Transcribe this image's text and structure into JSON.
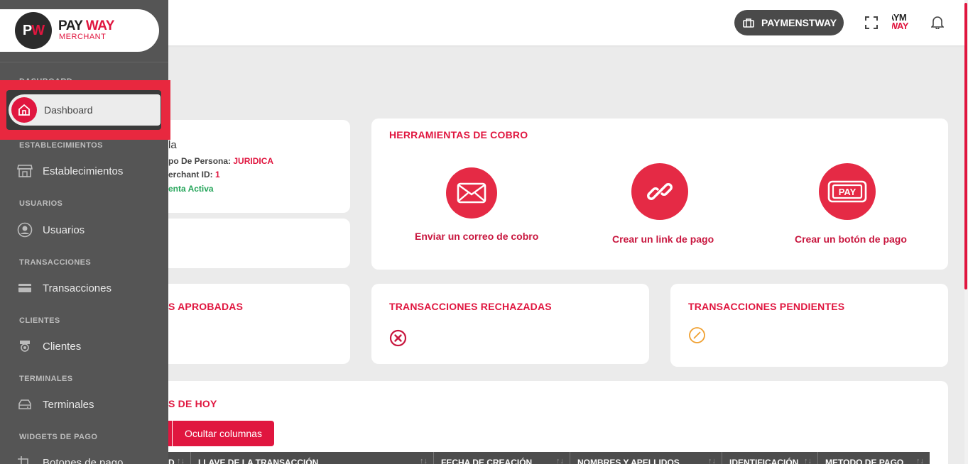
{
  "topbar": {
    "merchant_name": "PAYMENSTWAY",
    "mini_logo_line1": "AYM",
    "mini_logo_line2": "WAY"
  },
  "sidebar": {
    "logo_initials_p": "P",
    "logo_initials_w": "W",
    "logo_pay": "PAY",
    "logo_way": "WAY",
    "logo_sub": "MERCHANT",
    "hidden_section": "DASHBOARD",
    "active_item": "Dashboard",
    "sections": [
      {
        "title": "ESTABLECIMIENTOS",
        "item": "Establecimientos",
        "icon": "store-icon"
      },
      {
        "title": "USUARIOS",
        "item": "Usuarios",
        "icon": "user-icon"
      },
      {
        "title": "TRANSACCIONES",
        "item": "Transacciones",
        "icon": "card-icon"
      },
      {
        "title": "CLIENTES",
        "item": "Clientes",
        "icon": "clients-icon"
      },
      {
        "title": "TERMINALES",
        "item": "Terminales",
        "icon": "terminal-icon"
      },
      {
        "title": "WIDGETS DE PAGO",
        "item": "Botones de pago",
        "icon": "crop-icon"
      }
    ]
  },
  "profile": {
    "name": "la",
    "tipo_label": "po De Persona:",
    "tipo_value": "JURIDICA",
    "merchant_label": "erchant ID:",
    "merchant_value": "1",
    "status": "enta Activa"
  },
  "tools": {
    "title": "HERRAMIENTAS DE COBRO",
    "items": [
      {
        "label": "Enviar un correo de cobro",
        "icon": "mail-icon"
      },
      {
        "label": "Crear un link de pago",
        "icon": "link-icon"
      },
      {
        "label": "Crear un botón de pago",
        "icon": "pay-button-icon"
      }
    ],
    "pay_text": "PAY"
  },
  "stats": {
    "approved_title": "S APROBADAS",
    "rejected_title": "TRANSACCIONES RECHAZADAS",
    "pending_title": "TRANSACCIONES PENDIENTES",
    "colors": {
      "rejected": "#c8163e",
      "pending": "#f0a030"
    }
  },
  "today": {
    "title": "S DE HOY",
    "hide_columns": "Ocultar columnas",
    "columns": [
      "D",
      "LLAVE DE LA TRANSACCIÓN",
      "FECHA DE CREACIÓN",
      "NOMBRES Y APELLIDOS",
      "IDENTIFICACIÓN",
      "METODO DE PAGO"
    ]
  },
  "theme": {
    "accent": "#e0163f",
    "sidebar": "#555555"
  }
}
